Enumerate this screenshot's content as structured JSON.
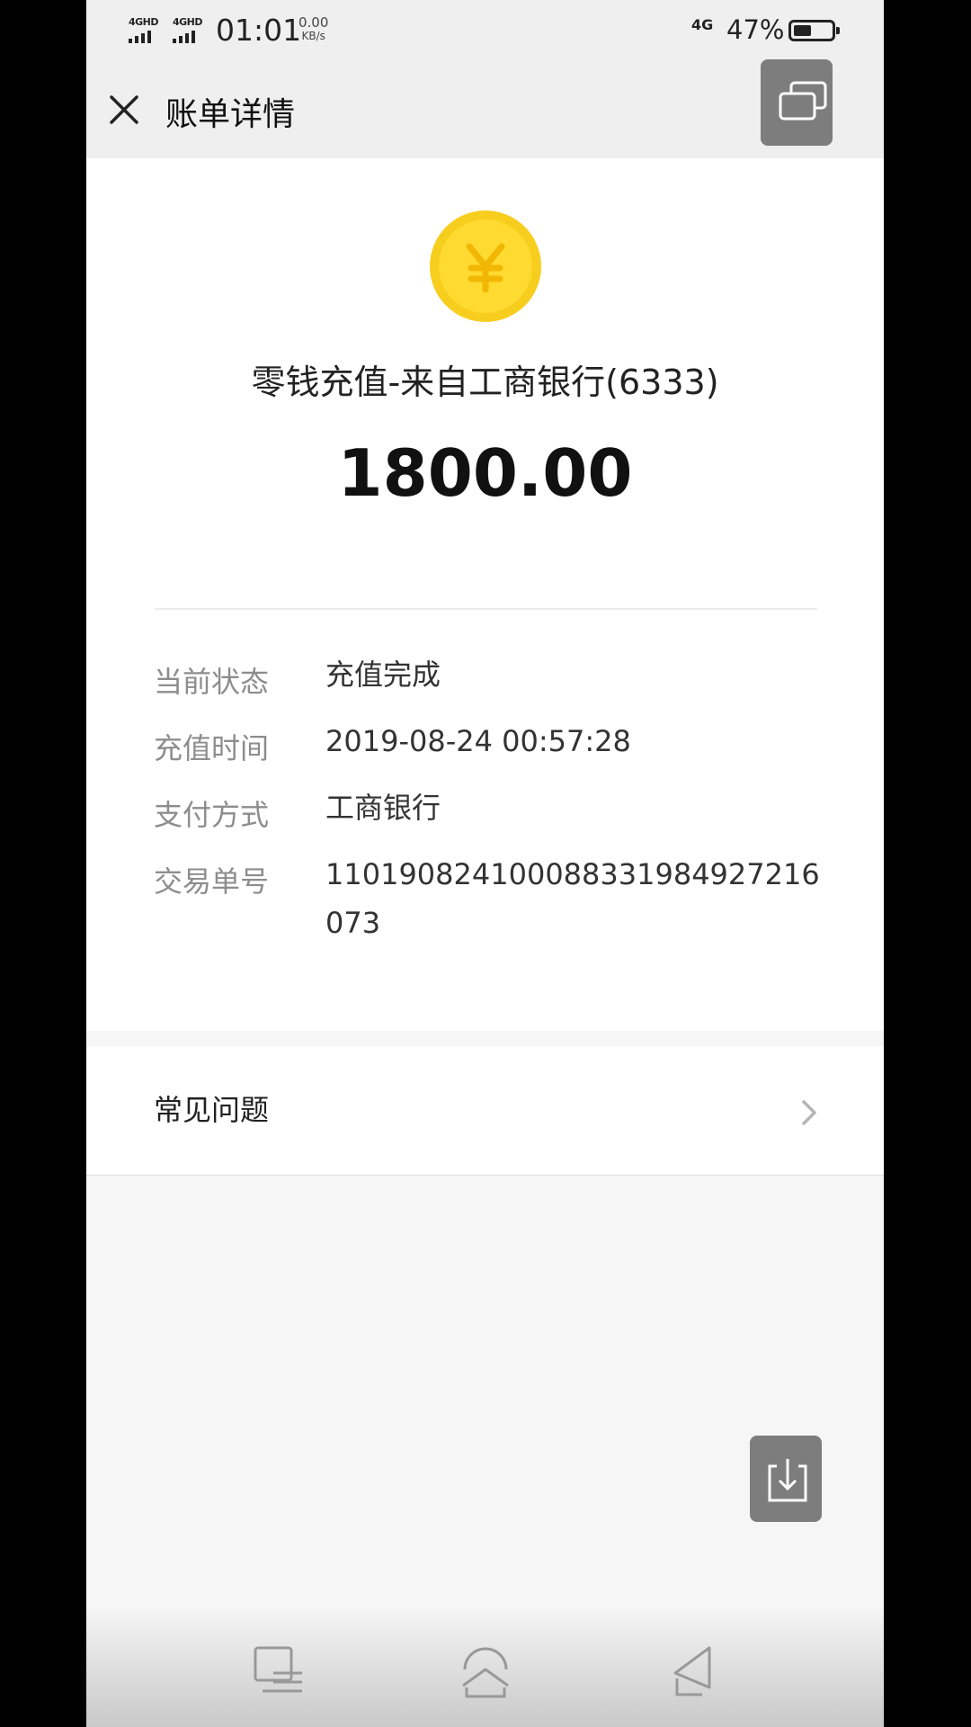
{
  "status_bar": {
    "sim1_label": "4GHD",
    "sim2_label": "4GHD",
    "time": "01:01",
    "speed_value": "0.00",
    "speed_unit": "KB/s",
    "network": "4G",
    "battery_percent": "47%",
    "battery_level": 0.47
  },
  "header": {
    "title": "账单详情",
    "close_icon": "close-icon",
    "float_window_icon": "window-icon"
  },
  "transaction": {
    "coin_icon": "yuan-coin-icon",
    "coin_color": "#f7ce1d",
    "title": "零钱充值-来自工商银行(6333)",
    "amount": "1800.00"
  },
  "details": {
    "status_label": "当前状态",
    "status_value": "充值完成",
    "time_label": "充值时间",
    "time_value": "2019-08-24 00:57:28",
    "payment_label": "支付方式",
    "payment_value": "工商银行",
    "order_label": "交易单号",
    "order_value": "110190824100088331984927216073"
  },
  "faq": {
    "label": "常见问题",
    "chevron_icon": "chevron-right-icon"
  },
  "floating": {
    "download_icon": "download-icon"
  },
  "nav_bar": {
    "menu_icon": "menu-icon",
    "home_icon": "home-icon",
    "back_icon": "back-icon"
  }
}
